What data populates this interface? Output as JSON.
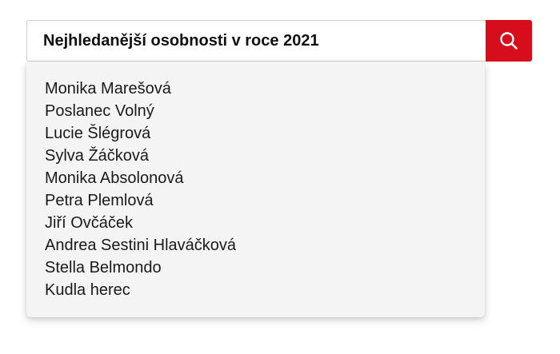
{
  "search": {
    "query": "Nejhledanější osobnosti v roce 2021",
    "button_icon": "search-icon",
    "accent_color": "#d70d1c"
  },
  "suggestions": {
    "items": [
      "Monika Marešová",
      "Poslanec Volný",
      "Lucie Šlégrová",
      "Sylva Žáčková",
      "Monika Absolonová",
      "Petra Plemlová",
      "Jiří Ovčáček",
      "Andrea Sestini Hlaváčková",
      "Stella Belmondo",
      "Kudla herec"
    ]
  }
}
